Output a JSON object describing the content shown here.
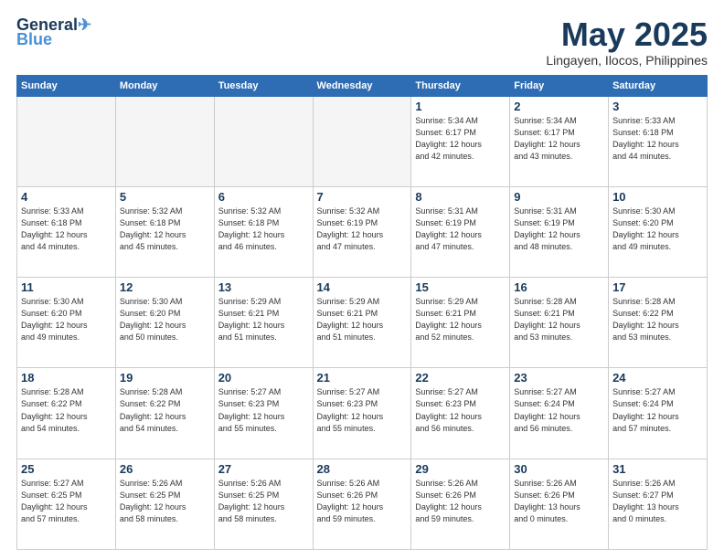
{
  "header": {
    "logo_line1": "General",
    "logo_line2": "Blue",
    "month_year": "May 2025",
    "location": "Lingayen, Ilocos, Philippines"
  },
  "weekdays": [
    "Sunday",
    "Monday",
    "Tuesday",
    "Wednesday",
    "Thursday",
    "Friday",
    "Saturday"
  ],
  "weeks": [
    [
      {
        "day": "",
        "info": ""
      },
      {
        "day": "",
        "info": ""
      },
      {
        "day": "",
        "info": ""
      },
      {
        "day": "",
        "info": ""
      },
      {
        "day": "1",
        "info": "Sunrise: 5:34 AM\nSunset: 6:17 PM\nDaylight: 12 hours\nand 42 minutes."
      },
      {
        "day": "2",
        "info": "Sunrise: 5:34 AM\nSunset: 6:17 PM\nDaylight: 12 hours\nand 43 minutes."
      },
      {
        "day": "3",
        "info": "Sunrise: 5:33 AM\nSunset: 6:18 PM\nDaylight: 12 hours\nand 44 minutes."
      }
    ],
    [
      {
        "day": "4",
        "info": "Sunrise: 5:33 AM\nSunset: 6:18 PM\nDaylight: 12 hours\nand 44 minutes."
      },
      {
        "day": "5",
        "info": "Sunrise: 5:32 AM\nSunset: 6:18 PM\nDaylight: 12 hours\nand 45 minutes."
      },
      {
        "day": "6",
        "info": "Sunrise: 5:32 AM\nSunset: 6:18 PM\nDaylight: 12 hours\nand 46 minutes."
      },
      {
        "day": "7",
        "info": "Sunrise: 5:32 AM\nSunset: 6:19 PM\nDaylight: 12 hours\nand 47 minutes."
      },
      {
        "day": "8",
        "info": "Sunrise: 5:31 AM\nSunset: 6:19 PM\nDaylight: 12 hours\nand 47 minutes."
      },
      {
        "day": "9",
        "info": "Sunrise: 5:31 AM\nSunset: 6:19 PM\nDaylight: 12 hours\nand 48 minutes."
      },
      {
        "day": "10",
        "info": "Sunrise: 5:30 AM\nSunset: 6:20 PM\nDaylight: 12 hours\nand 49 minutes."
      }
    ],
    [
      {
        "day": "11",
        "info": "Sunrise: 5:30 AM\nSunset: 6:20 PM\nDaylight: 12 hours\nand 49 minutes."
      },
      {
        "day": "12",
        "info": "Sunrise: 5:30 AM\nSunset: 6:20 PM\nDaylight: 12 hours\nand 50 minutes."
      },
      {
        "day": "13",
        "info": "Sunrise: 5:29 AM\nSunset: 6:21 PM\nDaylight: 12 hours\nand 51 minutes."
      },
      {
        "day": "14",
        "info": "Sunrise: 5:29 AM\nSunset: 6:21 PM\nDaylight: 12 hours\nand 51 minutes."
      },
      {
        "day": "15",
        "info": "Sunrise: 5:29 AM\nSunset: 6:21 PM\nDaylight: 12 hours\nand 52 minutes."
      },
      {
        "day": "16",
        "info": "Sunrise: 5:28 AM\nSunset: 6:21 PM\nDaylight: 12 hours\nand 53 minutes."
      },
      {
        "day": "17",
        "info": "Sunrise: 5:28 AM\nSunset: 6:22 PM\nDaylight: 12 hours\nand 53 minutes."
      }
    ],
    [
      {
        "day": "18",
        "info": "Sunrise: 5:28 AM\nSunset: 6:22 PM\nDaylight: 12 hours\nand 54 minutes."
      },
      {
        "day": "19",
        "info": "Sunrise: 5:28 AM\nSunset: 6:22 PM\nDaylight: 12 hours\nand 54 minutes."
      },
      {
        "day": "20",
        "info": "Sunrise: 5:27 AM\nSunset: 6:23 PM\nDaylight: 12 hours\nand 55 minutes."
      },
      {
        "day": "21",
        "info": "Sunrise: 5:27 AM\nSunset: 6:23 PM\nDaylight: 12 hours\nand 55 minutes."
      },
      {
        "day": "22",
        "info": "Sunrise: 5:27 AM\nSunset: 6:23 PM\nDaylight: 12 hours\nand 56 minutes."
      },
      {
        "day": "23",
        "info": "Sunrise: 5:27 AM\nSunset: 6:24 PM\nDaylight: 12 hours\nand 56 minutes."
      },
      {
        "day": "24",
        "info": "Sunrise: 5:27 AM\nSunset: 6:24 PM\nDaylight: 12 hours\nand 57 minutes."
      }
    ],
    [
      {
        "day": "25",
        "info": "Sunrise: 5:27 AM\nSunset: 6:25 PM\nDaylight: 12 hours\nand 57 minutes."
      },
      {
        "day": "26",
        "info": "Sunrise: 5:26 AM\nSunset: 6:25 PM\nDaylight: 12 hours\nand 58 minutes."
      },
      {
        "day": "27",
        "info": "Sunrise: 5:26 AM\nSunset: 6:25 PM\nDaylight: 12 hours\nand 58 minutes."
      },
      {
        "day": "28",
        "info": "Sunrise: 5:26 AM\nSunset: 6:26 PM\nDaylight: 12 hours\nand 59 minutes."
      },
      {
        "day": "29",
        "info": "Sunrise: 5:26 AM\nSunset: 6:26 PM\nDaylight: 12 hours\nand 59 minutes."
      },
      {
        "day": "30",
        "info": "Sunrise: 5:26 AM\nSunset: 6:26 PM\nDaylight: 13 hours\nand 0 minutes."
      },
      {
        "day": "31",
        "info": "Sunrise: 5:26 AM\nSunset: 6:27 PM\nDaylight: 13 hours\nand 0 minutes."
      }
    ]
  ]
}
